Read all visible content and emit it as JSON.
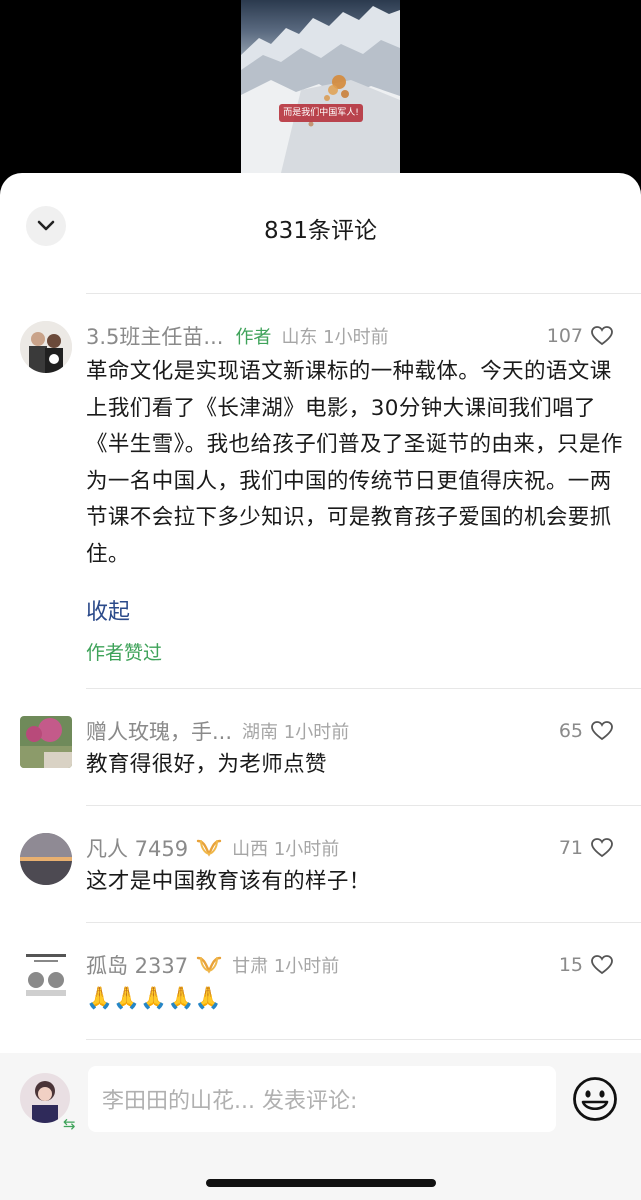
{
  "video": {
    "subtitle": "而是我们中国军人!"
  },
  "sheet": {
    "title": "831条评论"
  },
  "comments": [
    {
      "name": "3.5班主任苗...",
      "author_tag": "作者",
      "location": "山东 1小时前",
      "likes": "107",
      "text": "革命文化是实现语文新课标的一种载体。今天的语文课上我们看了《长津湖》电影，30分钟大课间我们唱了《半生雪》。我也给孩子们普及了圣诞节的由来，只是作为一名中国人，我们中国的传统节日更值得庆祝。一两节课不会拉下多少知识，可是教育孩子爱国的机会要抓住。",
      "collapse_label": "收起",
      "liked_by_author": "作者赞过"
    },
    {
      "name": "赠人玫瑰，手...",
      "location": "湖南 1小时前",
      "likes": "65",
      "text": "教育得很好，为老师点赞"
    },
    {
      "name": "凡人 7459",
      "location": "山西 1小时前",
      "likes": "71",
      "text": "这才是中国教育该有的样子！"
    },
    {
      "name": "孤岛 2337",
      "location": "甘肃 1小时前",
      "likes": "15",
      "text": "🙏🙏🙏🙏🙏"
    }
  ],
  "composer": {
    "placeholder": "李田田的山花... 发表评论:",
    "switch_icon": "⇆"
  },
  "colors": {
    "accent_green": "#3fa35a",
    "link_blue": "#2b4a8a"
  }
}
